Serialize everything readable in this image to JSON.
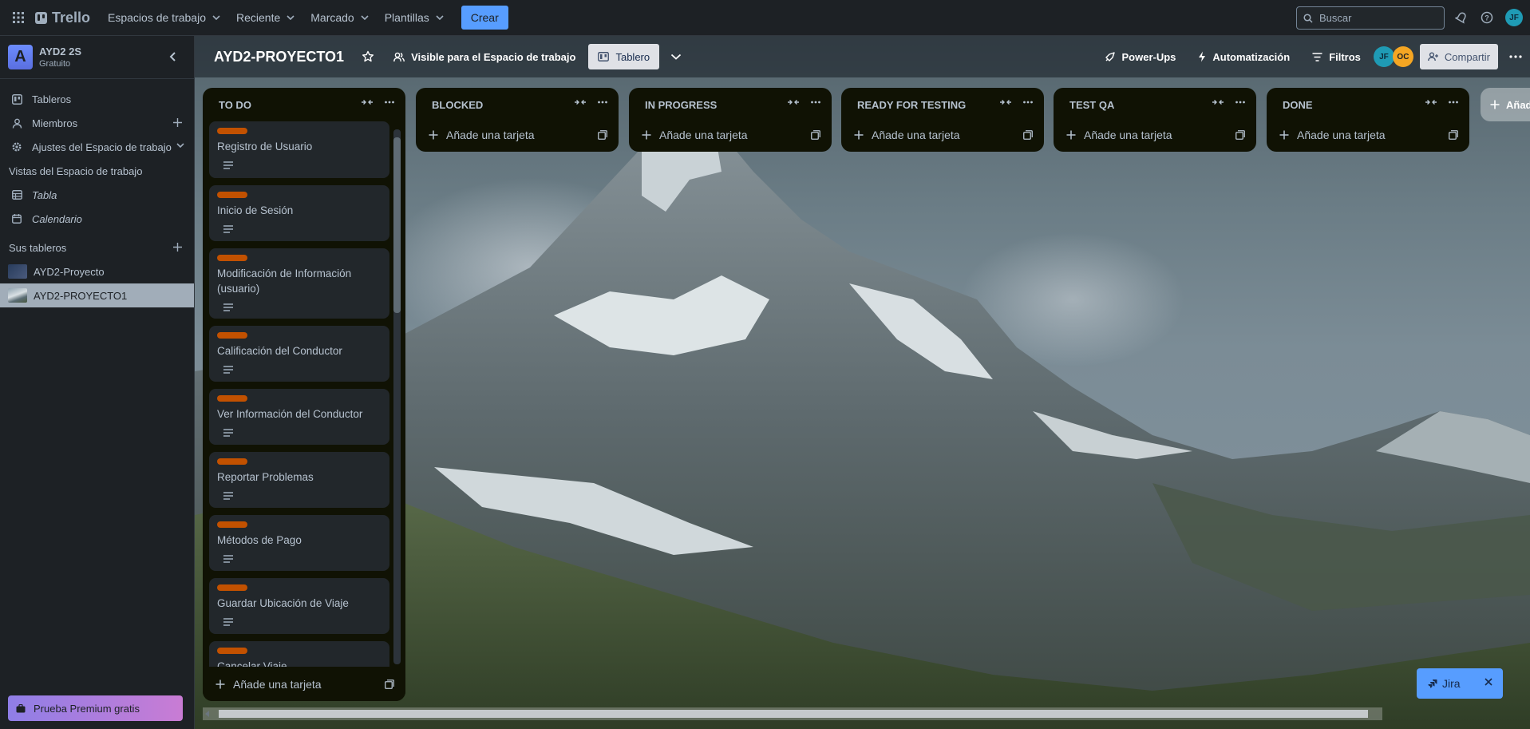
{
  "topbar": {
    "logo": "Trello",
    "menus": [
      "Espacios de trabajo",
      "Reciente",
      "Marcado",
      "Plantillas"
    ],
    "create_label": "Crear",
    "search_placeholder": "Buscar",
    "user_initials": "JF"
  },
  "sidebar": {
    "workspace_initial": "A",
    "workspace_name": "AYD2 2S",
    "workspace_plan": "Gratuito",
    "items": [
      {
        "label": "Tableros",
        "icon": "board-icon"
      },
      {
        "label": "Miembros",
        "icon": "person-icon"
      },
      {
        "label": "Ajustes del Espacio de trabajo",
        "icon": "gear-icon"
      }
    ],
    "views_title": "Vistas del Espacio de trabajo",
    "views": [
      {
        "label": "Tabla",
        "icon": "table-icon"
      },
      {
        "label": "Calendario",
        "icon": "calendar-icon"
      }
    ],
    "boards_title": "Sus tableros",
    "boards": [
      {
        "label": "AYD2-Proyecto",
        "active": false
      },
      {
        "label": "AYD2-PROYECTO1",
        "active": true
      }
    ],
    "premium_label": "Prueba Premium gratis"
  },
  "board": {
    "title": "AYD2-PROYECTO1",
    "visibility": "Visible para el Espacio de trabajo",
    "view_label": "Tablero",
    "powerups": "Power-Ups",
    "automation": "Automatización",
    "filters": "Filtros",
    "members": [
      "JF",
      "OC"
    ],
    "share": "Compartir",
    "add_list": "Añadir otra lista"
  },
  "lists": [
    {
      "title": "TO DO",
      "add_card": "Añade una tarjeta",
      "cards": [
        "Registro de Usuario",
        "Inicio de Sesión",
        "Modificación de Información (usuario)",
        "Calificación del Conductor",
        "Ver Información del Conductor",
        "Reportar Problemas",
        "Métodos de Pago",
        "Guardar Ubicación de Viaje",
        "Cancelar Viaje"
      ]
    },
    {
      "title": "BLOCKED",
      "add_card": "Añade una tarjeta",
      "cards": []
    },
    {
      "title": "IN PROGRESS",
      "add_card": "Añade una tarjeta",
      "cards": []
    },
    {
      "title": "READY FOR TESTING",
      "add_card": "Añade una tarjeta",
      "cards": []
    },
    {
      "title": "TEST QA",
      "add_card": "Añade una tarjeta",
      "cards": []
    },
    {
      "title": "DONE",
      "add_card": "Añade una tarjeta",
      "cards": []
    }
  ],
  "colors": {
    "label": "#c25100",
    "accent": "#579dff",
    "list_bg": "#101204"
  },
  "jira": {
    "label": "Jira"
  }
}
